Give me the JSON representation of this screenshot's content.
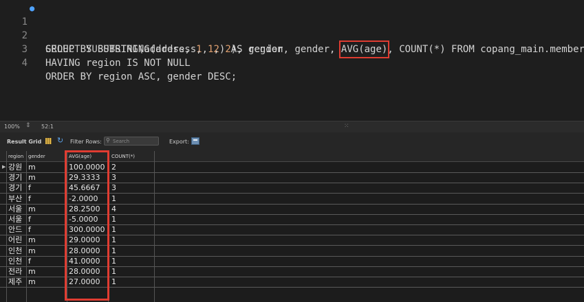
{
  "editor": {
    "lines": [
      {
        "num": "1",
        "code": "SELECT SUBSTRING(address, 1, 2) AS region, gender, AVG(age), COUNT(*) FROM copang_main.member"
      },
      {
        "num": "2",
        "code": "GROUP BY SUBSTRING(address, 1, 2), gender"
      },
      {
        "num": "3",
        "code": "HAVING region IS NOT NULL"
      },
      {
        "num": "4",
        "code": "ORDER BY region ASC, gender DESC;"
      }
    ],
    "line1_parts": {
      "a": "SELECT SUBSTRING(address, ",
      "n1": "1",
      "b": ", ",
      "n2": "2",
      "c": ") AS region, gender, ",
      "hl": "AVG(age)",
      "d": ", COUNT(*) FROM copang_main.member"
    },
    "line2_parts": {
      "a": "GROUP BY SUBSTRING(address, ",
      "n1": "1",
      "b": ", ",
      "n2": "2",
      "c": "), gender"
    }
  },
  "status": {
    "zoom": "100%",
    "cursor_pos": "52:1"
  },
  "toolbar": {
    "result_grid_label": "Result Grid",
    "filter_label": "Filter Rows:",
    "search_placeholder": "Search",
    "export_label": "Export:"
  },
  "grid": {
    "columns": [
      "region",
      "gender",
      "AVG(age)",
      "COUNT(*)"
    ],
    "rows": [
      [
        "강원",
        "m",
        "100.0000",
        "2"
      ],
      [
        "경기",
        "m",
        "29.3333",
        "3"
      ],
      [
        "경기",
        "f",
        "45.6667",
        "3"
      ],
      [
        "부산",
        "f",
        "-2.0000",
        "1"
      ],
      [
        "서울",
        "m",
        "28.2500",
        "4"
      ],
      [
        "서울",
        "f",
        "-5.0000",
        "1"
      ],
      [
        "안드",
        "f",
        "300.0000",
        "1"
      ],
      [
        "어린",
        "m",
        "29.0000",
        "1"
      ],
      [
        "인천",
        "m",
        "28.0000",
        "1"
      ],
      [
        "인천",
        "f",
        "41.0000",
        "1"
      ],
      [
        "전라",
        "m",
        "28.0000",
        "1"
      ],
      [
        "제주",
        "m",
        "27.0000",
        "1"
      ]
    ]
  },
  "colors": {
    "highlight": "#e03c31",
    "background": "#1e1e1e"
  }
}
